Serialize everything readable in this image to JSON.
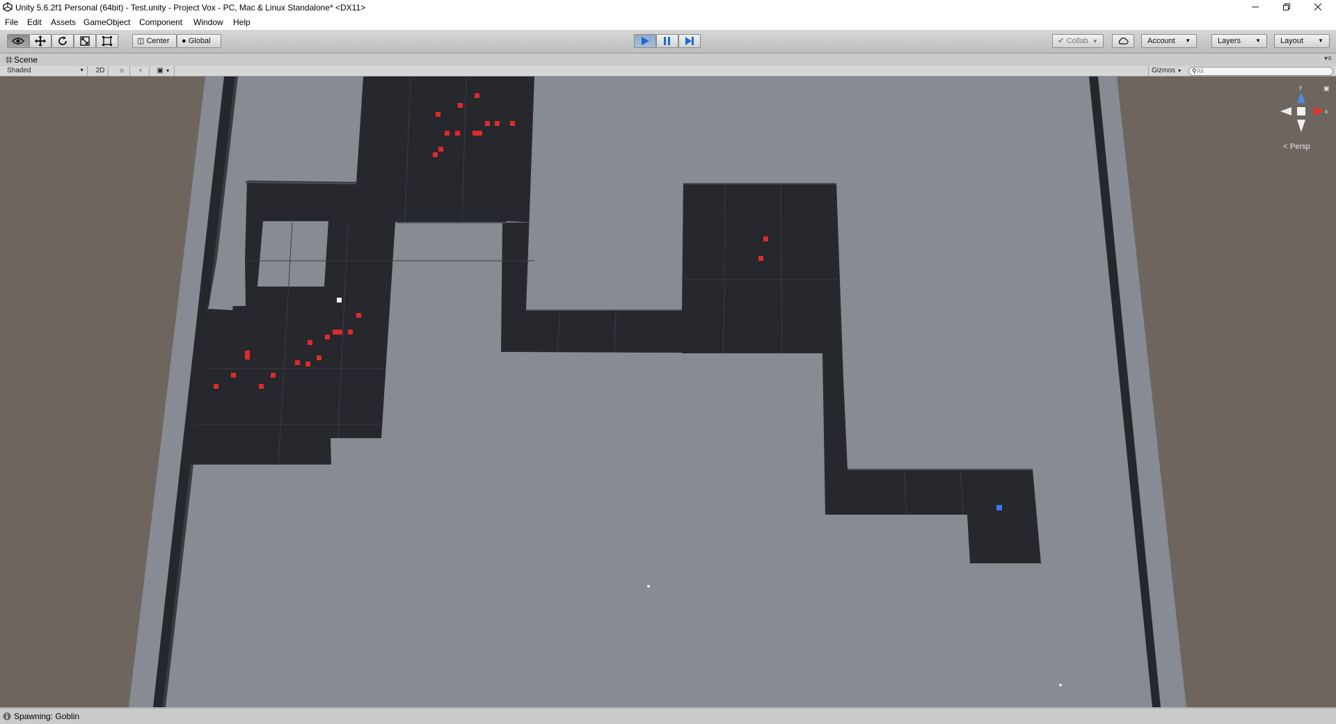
{
  "window": {
    "title": "Unity 5.6.2f1 Personal (64bit) - Test.unity - Project Vox - PC, Mac & Linux Standalone* <DX11>",
    "controls": [
      "minimize",
      "restore",
      "close"
    ]
  },
  "menu": {
    "items": [
      "File",
      "Edit",
      "Assets",
      "GameObject",
      "Component",
      "Window",
      "Help"
    ]
  },
  "toolbar": {
    "tools": [
      "view-tool",
      "move-tool",
      "rotate-tool",
      "scale-tool",
      "rect-tool"
    ],
    "active_tool": "view-tool",
    "pivot_mode": "Center",
    "pivot_rotation": "Global",
    "play_state": "playing",
    "collab": "Collab",
    "account": "Account",
    "layers": "Layers",
    "layout": "Layout"
  },
  "scene_tab": {
    "label": "Scene"
  },
  "scene_bar": {
    "draw_mode": "Shaded",
    "mode_2d": "2D",
    "gizmos": "Gizmos",
    "search_placeholder": "All"
  },
  "gizmo": {
    "axis_y": "y",
    "axis_x": "x",
    "axis_z": "z",
    "projection": "Persp"
  },
  "status": {
    "message": "Spawning: Goblin"
  },
  "colors": {
    "floor": "#868b94",
    "walls": "#25272c",
    "background": "#6e655f",
    "enemy": "#e02a2a",
    "player": "#3a78e6",
    "play_accent": "#4a8cd8"
  }
}
